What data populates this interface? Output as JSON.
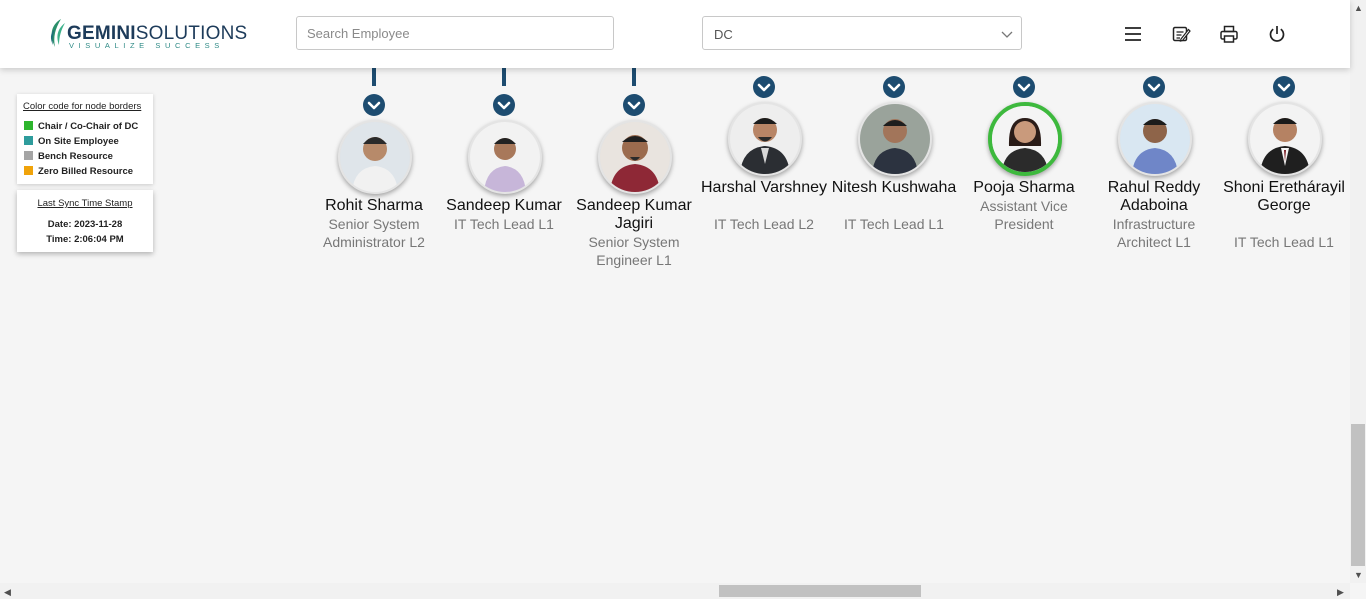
{
  "header": {
    "logo": {
      "name_bold": "GEMINI",
      "name_rest": "SOLUTIONS",
      "tagline": "VISUALIZE SUCCESS"
    },
    "search": {
      "placeholder": "Search Employee",
      "value": ""
    },
    "select": {
      "value": "DC"
    },
    "tools": [
      "menu-icon",
      "edit-note-icon",
      "print-icon",
      "power-icon"
    ]
  },
  "legend": {
    "title": "Color code for node borders",
    "items": [
      {
        "label": "Chair / Co-Chair of DC",
        "color": "#2db52d"
      },
      {
        "label": "On Site Employee",
        "color": "#2e9c9c"
      },
      {
        "label": "Bench Resource",
        "color": "#a5a5a5"
      },
      {
        "label": "Zero Billed Resource",
        "color": "#f0a30a"
      }
    ]
  },
  "sync": {
    "title": "Last Sync Time Stamp",
    "date": "Date: 2023-11-28",
    "time": "Time: 2:06:04 PM"
  },
  "colors": {
    "connector": "#1d4c70",
    "chair_border": "#3db93d"
  },
  "nodes": [
    {
      "name": "Rohit Sharma",
      "title": "Senior System Administrator L2",
      "chair": false
    },
    {
      "name": "Sandeep Kumar",
      "title": "IT Tech Lead L1",
      "chair": false
    },
    {
      "name": "Sandeep Kumar Jagiri",
      "title": "Senior System Engineer L1",
      "chair": false
    },
    {
      "name": "Harshal Varshney",
      "title": "IT Tech Lead L2",
      "chair": false
    },
    {
      "name": "Nitesh Kushwaha",
      "title": "IT Tech Lead L1",
      "chair": false
    },
    {
      "name": "Pooja Sharma",
      "title": "Assistant Vice President",
      "chair": true
    },
    {
      "name": "Rahul Reddy Adaboina",
      "title": "Infrastructure Architect L1",
      "chair": false
    },
    {
      "name": "Shoni Erethárayil George",
      "title": "IT Tech Lead L1",
      "chair": false
    }
  ]
}
